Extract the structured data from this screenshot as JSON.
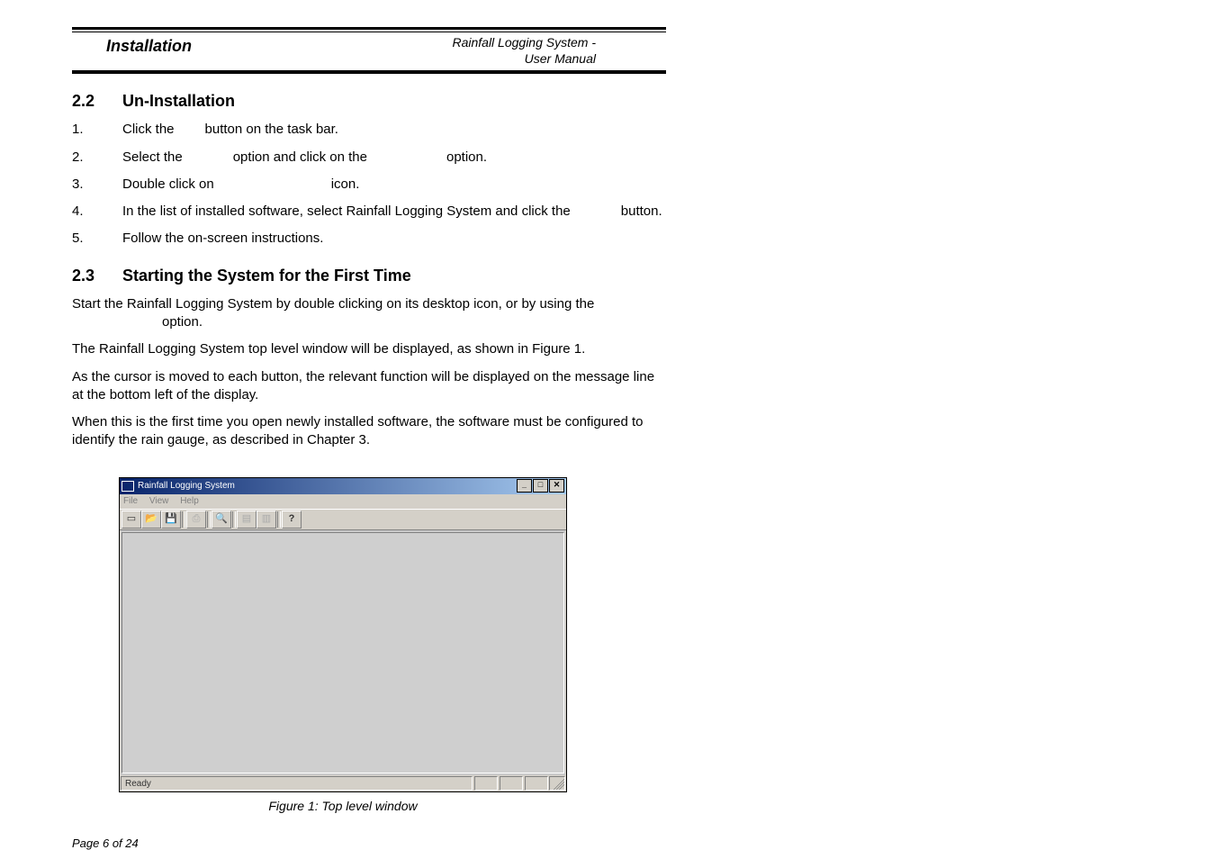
{
  "header": {
    "section": "Installation",
    "doc_title_line1": "Rainfall Logging System -",
    "doc_title_line2": "User Manual"
  },
  "sec22": {
    "num": "2.2",
    "title": "Un-Installation",
    "steps": [
      {
        "n": "1.",
        "a": "Click the",
        "b": "button on the task bar."
      },
      {
        "n": "2.",
        "a": "Select the",
        "b": "option and click on the",
        "c": "option."
      },
      {
        "n": "3.",
        "a": "Double click on",
        "b": "icon."
      },
      {
        "n": "4.",
        "a": "In the list of installed software, select Rainfall Logging System and click the",
        "b": "button."
      },
      {
        "n": "5.",
        "a": "Follow the on-screen instructions."
      }
    ]
  },
  "sec23": {
    "num": "2.3",
    "title": "Starting the System for the First Time",
    "p1a": "Start the Rainfall Logging System by double clicking on its desktop icon, or by using the",
    "p1b": "option.",
    "p2": "The Rainfall Logging System top level window will be displayed, as shown in Figure 1.",
    "p3": "As the cursor is moved to each button, the relevant function will be displayed on the message line at the bottom left of the display.",
    "p4": "When this is the first time you open newly installed software, the software must be configured to identify the rain gauge, as described in Chapter 3."
  },
  "figure": {
    "title": "Rainfall Logging System",
    "menu": {
      "file": "File",
      "view": "View",
      "help": "Help"
    },
    "toolbar_icons": [
      "new",
      "open",
      "save",
      "print",
      "preview",
      "chart",
      "table",
      "help"
    ],
    "status": "Ready",
    "caption": "Figure 1: Top level window"
  },
  "footer": {
    "page": "Page 6 of 24"
  }
}
